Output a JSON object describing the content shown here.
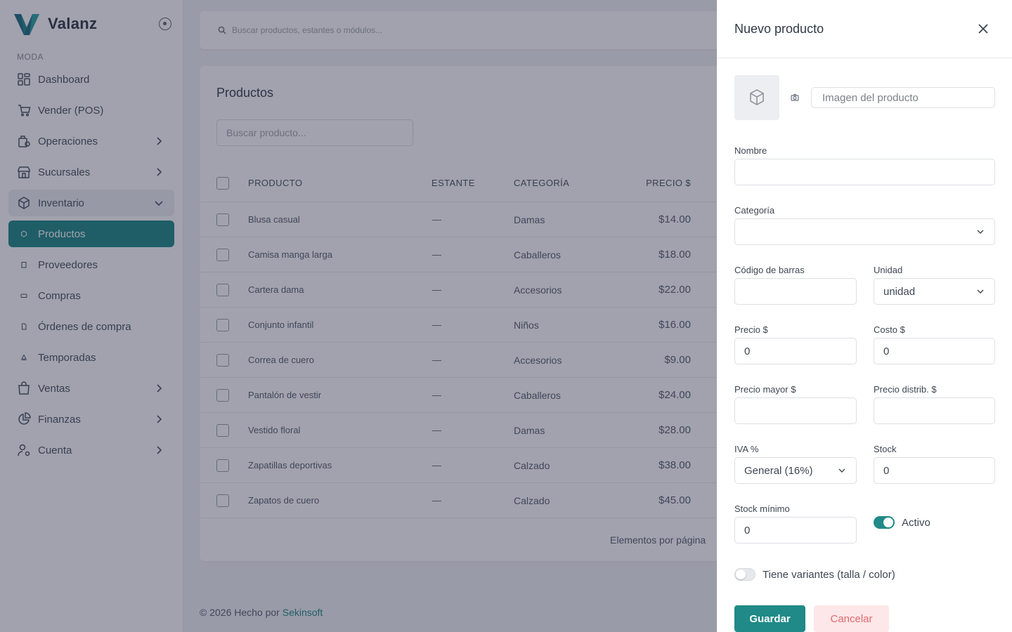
{
  "app": {
    "name": "Valanz"
  },
  "sidebar": {
    "section": "MODA",
    "items": [
      {
        "label": "Dashboard",
        "icon": "dashboard-icon"
      },
      {
        "label": "Vender (POS)",
        "icon": "cart-icon"
      },
      {
        "label": "Operaciones",
        "icon": "operations-icon"
      },
      {
        "label": "Sucursales",
        "icon": "store-icon"
      },
      {
        "label": "Inventario",
        "icon": "box-icon"
      },
      {
        "label": "Productos",
        "icon": "dot-icon"
      },
      {
        "label": "Proveedores",
        "icon": "dot-icon"
      },
      {
        "label": "Compras",
        "icon": "dot-icon"
      },
      {
        "label": "Órdenes de compra",
        "icon": "dot-icon"
      },
      {
        "label": "Temporadas",
        "icon": "dot-icon"
      },
      {
        "label": "Ventas",
        "icon": "bag-icon"
      },
      {
        "label": "Finanzas",
        "icon": "pie-chart-icon"
      },
      {
        "label": "Cuenta",
        "icon": "user-settings-icon"
      }
    ]
  },
  "topbar": {
    "search_placeholder": "Buscar productos, estantes o módulos..."
  },
  "products": {
    "title": "Productos",
    "search_placeholder": "Buscar producto...",
    "columns": {
      "product": "PRODUCTO",
      "shelf": "ESTANTE",
      "category": "CATEGORÍA",
      "price": "PRECIO $"
    },
    "rows": [
      {
        "name": "Blusa casual",
        "shelf": "—",
        "category": "Damas",
        "price": "$14.00"
      },
      {
        "name": "Camisa manga larga",
        "shelf": "—",
        "category": "Caballeros",
        "price": "$18.00"
      },
      {
        "name": "Cartera dama",
        "shelf": "—",
        "category": "Accesorios",
        "price": "$22.00"
      },
      {
        "name": "Conjunto infantil",
        "shelf": "—",
        "category": "Niños",
        "price": "$16.00"
      },
      {
        "name": "Correa de cuero",
        "shelf": "—",
        "category": "Accesorios",
        "price": "$9.00"
      },
      {
        "name": "Pantalón de vestir",
        "shelf": "—",
        "category": "Caballeros",
        "price": "$24.00"
      },
      {
        "name": "Vestido floral",
        "shelf": "—",
        "category": "Damas",
        "price": "$28.00"
      },
      {
        "name": "Zapatillas deportivas",
        "shelf": "—",
        "category": "Calzado",
        "price": "$38.00"
      },
      {
        "name": "Zapatos de cuero",
        "shelf": "—",
        "category": "Calzado",
        "price": "$45.00"
      }
    ],
    "pagination_label": "Elementos por página"
  },
  "footer": {
    "text": "© 2026 Hecho por ",
    "brand": "Sekinsoft"
  },
  "drawer": {
    "title": "Nuevo producto",
    "image_placeholder": "Imagen del producto",
    "fields": {
      "nombre": {
        "label": "Nombre",
        "value": ""
      },
      "categoria": {
        "label": "Categoría",
        "value": ""
      },
      "codigo": {
        "label": "Código de barras",
        "value": ""
      },
      "unidad": {
        "label": "Unidad",
        "value": "unidad"
      },
      "precio": {
        "label": "Precio $",
        "value": "0"
      },
      "costo": {
        "label": "Costo $",
        "value": "0"
      },
      "precio_mayor": {
        "label": "Precio mayor $",
        "value": ""
      },
      "precio_distrib": {
        "label": "Precio distrib. $",
        "value": ""
      },
      "iva": {
        "label": "IVA %",
        "value": "General (16%)"
      },
      "stock": {
        "label": "Stock",
        "value": "0"
      },
      "stock_minimo": {
        "label": "Stock mínimo",
        "value": "0"
      }
    },
    "activo": {
      "label": "Activo",
      "on": true
    },
    "variantes": {
      "label": "Tiene variantes (talla / color)",
      "on": false
    },
    "save": "Guardar",
    "cancel": "Cancelar"
  },
  "colors": {
    "accent": "#1f8a87",
    "cancel_bg": "#fde7e8",
    "cancel_text": "#e26a6f"
  }
}
